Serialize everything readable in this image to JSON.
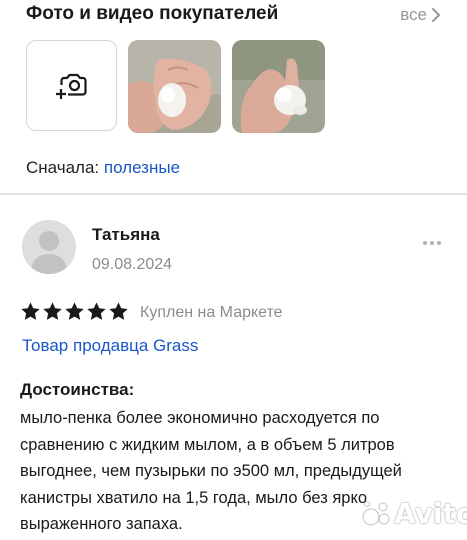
{
  "header": {
    "title": "Фото и видео покупателей",
    "all_label": "все"
  },
  "photos": {
    "add_icon": "add-photo-camera-icon",
    "items": [
      {
        "alt": "фото покупателя 1"
      },
      {
        "alt": "фото покупателя 2"
      }
    ]
  },
  "sort": {
    "label": "Сначала:",
    "value": "полезные"
  },
  "review": {
    "author": "Татьяна",
    "date": "09.08.2024",
    "rating": 5,
    "rating_max": 5,
    "bought_badge": "Куплен на Маркете",
    "seller_link": "Товар продавца Grass",
    "pros_title": "Достоинства:",
    "pros_text": "мыло-пенка более экономично расходуется по сравнению с жидким мылом, а в объем 5 литров выгоднее, чем пузырьки по э500 мл, предыдущей канистры хватило на 1,5 года, мыло без ярко выраженного запаха."
  },
  "watermark": {
    "text": "Avito"
  },
  "colors": {
    "link": "#1a56c6",
    "star": "#1a1a1a",
    "muted": "#8c8c8c",
    "divider": "#e4e4e4"
  }
}
